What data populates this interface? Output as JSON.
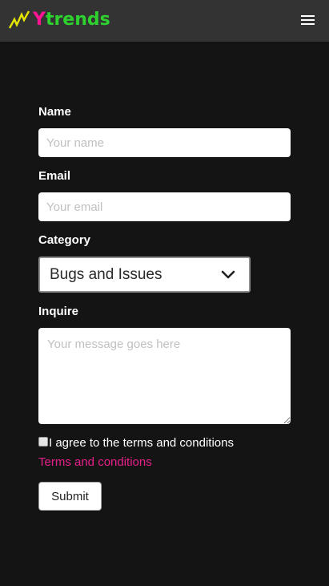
{
  "header": {
    "logo_first": "Y",
    "logo_rest": "trends",
    "colors": {
      "logo_icon": "#e6e600",
      "logo_first": "#ff1493",
      "logo_rest": "#2ed12e",
      "background": "#333333"
    },
    "menu_icon": "hamburger-icon"
  },
  "form": {
    "name_label": "Name",
    "name_placeholder": "Your name",
    "name_value": "",
    "email_label": "Email",
    "email_placeholder": "Your email",
    "email_value": "",
    "category_label": "Category",
    "category_value": "Bugs and Issues",
    "inquire_label": "Inquire",
    "inquire_placeholder": "Your message goes here",
    "inquire_value": "",
    "agree_text": "I agree to the terms and conditions",
    "agree_checked": false,
    "terms_link": "Terms and conditions",
    "submit_label": "Submit",
    "colors": {
      "page_background": "#141414",
      "link": "#e8208c"
    }
  }
}
